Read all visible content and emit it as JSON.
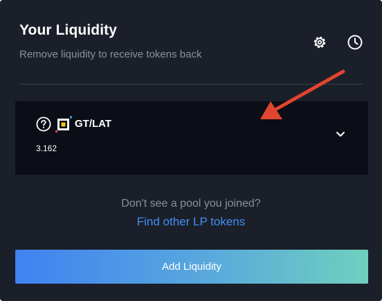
{
  "header": {
    "title": "Your Liquidity",
    "subtitle": "Remove liquidity to receive tokens back",
    "icons": [
      "gear-icon",
      "clock-icon"
    ]
  },
  "pool": {
    "pair": "GT/LAT",
    "balance": "3.162",
    "icons": [
      "question-circle-icon",
      "token-logo-icon",
      "chevron-down-icon"
    ]
  },
  "footer": {
    "hint": "Don't see a pool you joined?",
    "link": "Find other LP tokens",
    "add_label": "Add Liquidity"
  },
  "colors": {
    "panel_bg": "#1b1f29",
    "row_bg": "#0b0e16",
    "link": "#3f8ef5",
    "annotation_arrow": "#e2452f",
    "button_gradient": [
      "#3f82f2",
      "#6fd0be"
    ]
  }
}
